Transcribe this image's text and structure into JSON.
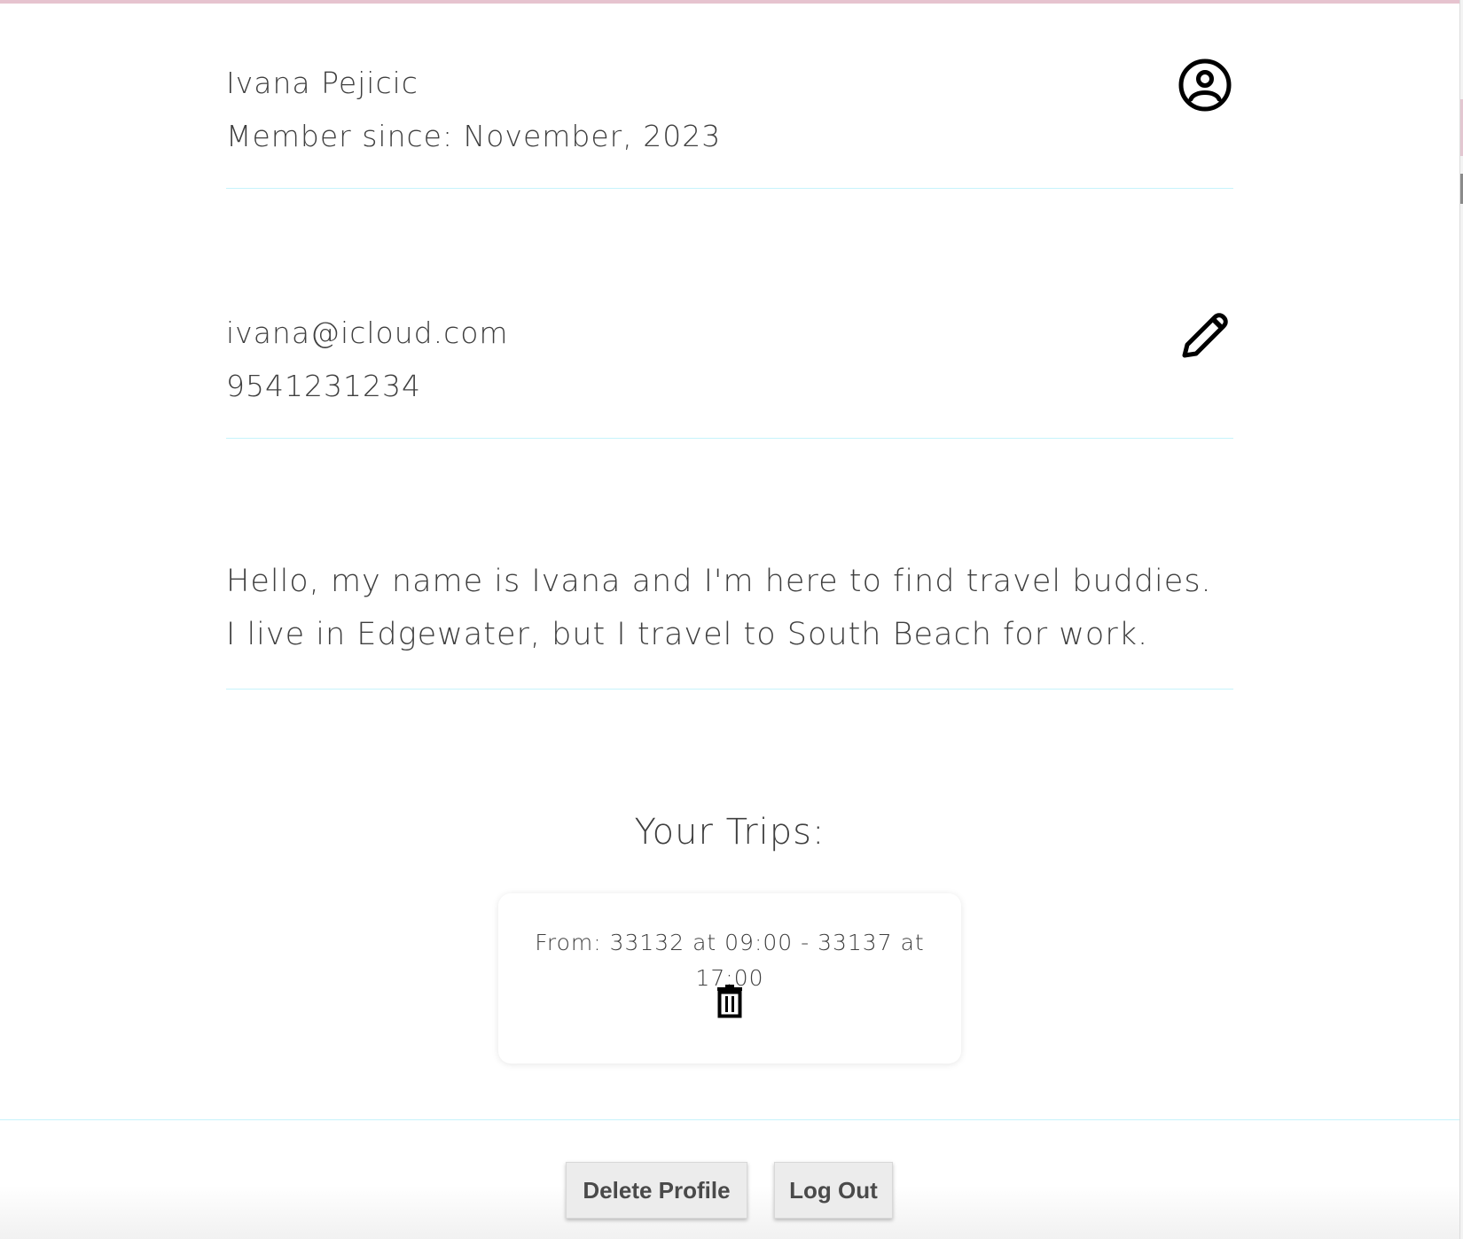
{
  "profile": {
    "name": "Ivana Pejicic",
    "member_since": "Member since: November, 2023",
    "account_icon": "account-circle-icon"
  },
  "contact": {
    "email": "ivana@icloud.com",
    "phone": "9541231234",
    "edit_icon": "pencil-icon"
  },
  "bio": {
    "text": "Hello, my name is Ivana and I'm here to find travel buddies. I live in Edgewater, but I travel to South Beach for work."
  },
  "trips": {
    "title": "Your Trips:",
    "items": [
      {
        "summary": "From: 33132 at 09:00 - 33137 at 17:00",
        "delete_icon": "trash-icon"
      }
    ]
  },
  "footer": {
    "delete_profile_label": "Delete Profile",
    "log_out_label": "Log Out"
  },
  "colors": {
    "divider": "#c6f3fb",
    "text": "#3f3f3f",
    "button_bg": "#ececec",
    "top_strip": "#e6c3cf"
  }
}
